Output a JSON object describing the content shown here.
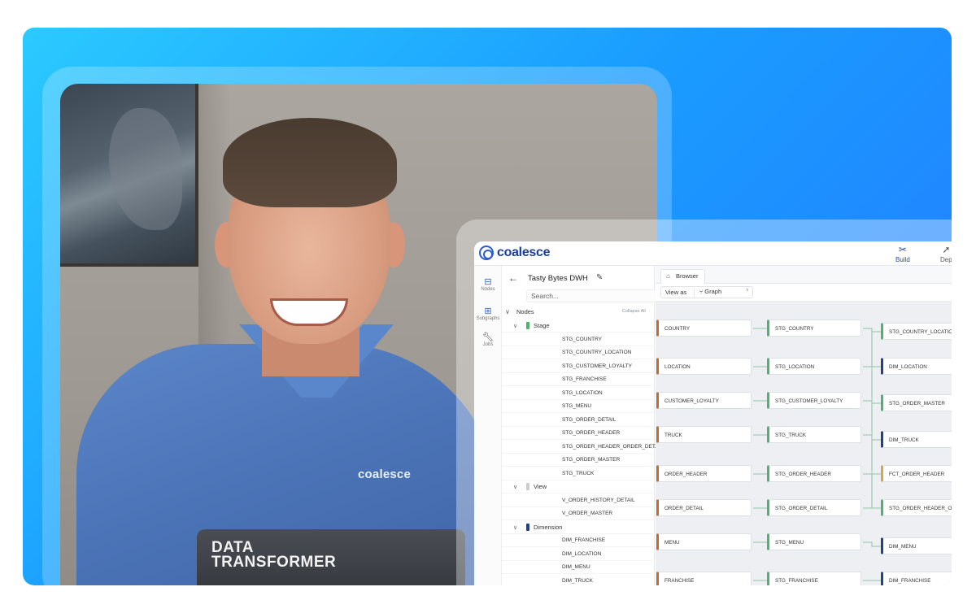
{
  "app": {
    "brand": "coalesce",
    "brand_color": "#1d3e9c",
    "accent": "#2a5bd7",
    "topbar": {
      "build_label": "Build",
      "deploy_label": "Dep"
    },
    "rail": [
      {
        "icon": "nodes-icon",
        "label": "Nodes"
      },
      {
        "icon": "subgraphs-icon",
        "label": "Subgraphs"
      },
      {
        "icon": "wrench-icon",
        "label": "Jobs"
      }
    ],
    "project": {
      "name": "Tasty Bytes DWH"
    },
    "search": {
      "placeholder": "Search..."
    },
    "tree": {
      "root_label": "Nodes",
      "collapse_label": "Collapse All",
      "groups": [
        {
          "label": "Stage",
          "color": "#4fb36f",
          "items": [
            "STG_COUNTRY",
            "STG_COUNTRY_LOCATION",
            "STG_CUSTOMER_LOYALTY",
            "STG_FRANCHISE",
            "STG_LOCATION",
            "STG_MENU",
            "STG_ORDER_DETAIL",
            "STG_ORDER_HEADER",
            "STG_ORDER_HEADER_ORDER_DETAIL",
            "STG_ORDER_MASTER",
            "STG_TRUCK"
          ]
        },
        {
          "label": "View",
          "color": "#cccccc",
          "items": [
            "V_ORDER_HISTORY_DETAIL",
            "V_ORDER_MASTER"
          ]
        },
        {
          "label": "Dimension",
          "color": "#23408f",
          "items": [
            "DIM_FRANCHISE",
            "DIM_LOCATION",
            "DIM_MENU",
            "DIM_TRUCK"
          ]
        }
      ]
    },
    "browser_tab": "Browser",
    "view_as": {
      "label": "View as",
      "value": "Graph"
    },
    "graph": {
      "col1": [
        "COUNTRY",
        "LOCATION",
        "CUSTOMER_LOYALTY",
        "TRUCK",
        "ORDER_HEADER",
        "ORDER_DETAIL",
        "MENU",
        "FRANCHISE"
      ],
      "col2": [
        "STG_COUNTRY",
        "STG_LOCATION",
        "STG_CUSTOMER_LOYALTY",
        "STG_TRUCK",
        "STG_ORDER_HEADER",
        "STG_ORDER_DETAIL",
        "STG_MENU",
        "STG_FRANCHISE"
      ],
      "col3": [
        {
          "label": "STG_COUNTRY_LOCATION",
          "kind": "stg"
        },
        {
          "label": "DIM_LOCATION",
          "kind": "dim"
        },
        {
          "label": "STG_ORDER_MASTER",
          "kind": "stg"
        },
        {
          "label": "DIM_TRUCK",
          "kind": "dim"
        },
        {
          "label": "FCT_ORDER_HEADER",
          "kind": "fct"
        },
        {
          "label": "STG_ORDER_HEADER_ORDER_DETAIL",
          "kind": "stg"
        },
        {
          "label": "DIM_MENU",
          "kind": "dim"
        },
        {
          "label": "DIM_FRANCHISE",
          "kind": "dim"
        }
      ]
    }
  },
  "photo": {
    "shirt_logo": "coalesce",
    "laptop_sticker_line1": "DATA",
    "laptop_sticker_line2": "TRANSFORMER"
  }
}
